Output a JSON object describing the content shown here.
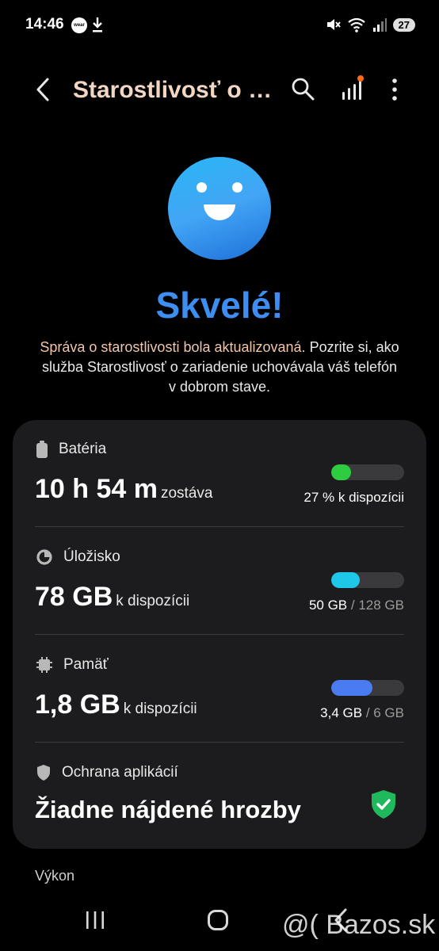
{
  "status_bar": {
    "time": "14:46",
    "wear_badge": "wear",
    "battery": "27"
  },
  "app_bar": {
    "title": "Starostlivosť o zariadenie"
  },
  "hero": {
    "headline": "Skvelé!",
    "desc_highlight": "Správa o starostlivosti bola aktualizovaná.",
    "desc_rest": " Pozrite si, ako služba Starostlivosť o zariadenie uchovávala váš telefón v dobrom stave."
  },
  "battery": {
    "label": "Batéria",
    "value": "10 h 54 m",
    "suffix": "zostáva",
    "info": "27 % k dispozícii",
    "level": 0.27,
    "color": "#2ecc40"
  },
  "storage": {
    "label": "Úložisko",
    "value": "78 GB",
    "suffix": "k dispozícii",
    "used": "50 GB",
    "total": "/ 128 GB",
    "level": 0.39,
    "color": "#1ec8e8"
  },
  "memory": {
    "label": "Pamäť",
    "value": "1,8 GB",
    "suffix": "k dispozícii",
    "used": "3,4 GB",
    "total": "/ 6 GB",
    "level": 0.57,
    "color": "#4a7bf0"
  },
  "app_protection": {
    "label": "Ochrana aplikácií",
    "status": "Žiadne nájdené hrozby"
  },
  "performance": {
    "label": "Výkon"
  },
  "watermark": "@( Bazos.sk"
}
